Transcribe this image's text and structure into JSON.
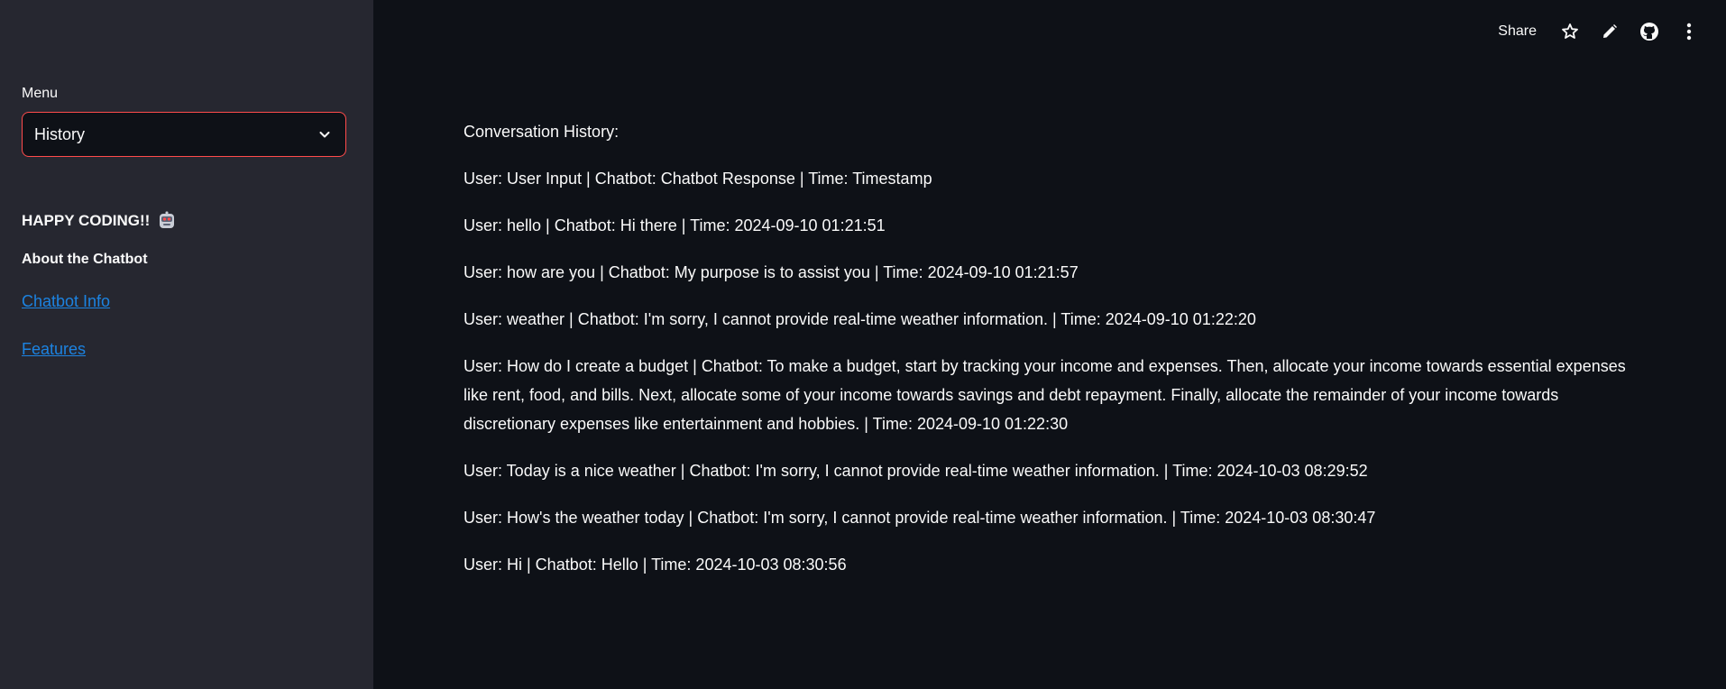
{
  "sidebar": {
    "menu_label": "Menu",
    "select_value": "History",
    "happy_coding": "HAPPY CODING!!",
    "about_title": "About the Chatbot",
    "links": [
      {
        "label": "Chatbot Info"
      },
      {
        "label": "Features"
      }
    ]
  },
  "header": {
    "share_label": "Share",
    "icons": [
      "star-icon",
      "pencil-icon",
      "github-icon",
      "more-vertical-icon"
    ]
  },
  "main": {
    "heading": "Conversation History:",
    "lines": [
      "User: User Input | Chatbot: Chatbot Response | Time: Timestamp",
      "User: hello | Chatbot: Hi there | Time: 2024-09-10 01:21:51",
      "User: how are you | Chatbot: My purpose is to assist you | Time: 2024-09-10 01:21:57",
      "User: weather | Chatbot: I'm sorry, I cannot provide real-time weather information. | Time: 2024-09-10 01:22:20",
      "User: How do I create a budget | Chatbot: To make a budget, start by tracking your income and expenses. Then, allocate your income towards essential expenses like rent, food, and bills. Next, allocate some of your income towards savings and debt repayment. Finally, allocate the remainder of your income towards discretionary expenses like entertainment and hobbies. | Time: 2024-09-10 01:22:30",
      "User: Today is a nice weather | Chatbot: I'm sorry, I cannot provide real-time weather information. | Time: 2024-10-03 08:29:52",
      "User: How's the weather today | Chatbot: I'm sorry, I cannot provide real-time weather information. | Time: 2024-10-03 08:30:47",
      "User: Hi | Chatbot: Hello | Time: 2024-10-03 08:30:56"
    ]
  },
  "colors": {
    "accent": "#ff4b4b",
    "link": "#1c83e1",
    "sidebar_bg": "#262730",
    "main_bg": "#0e1117"
  }
}
